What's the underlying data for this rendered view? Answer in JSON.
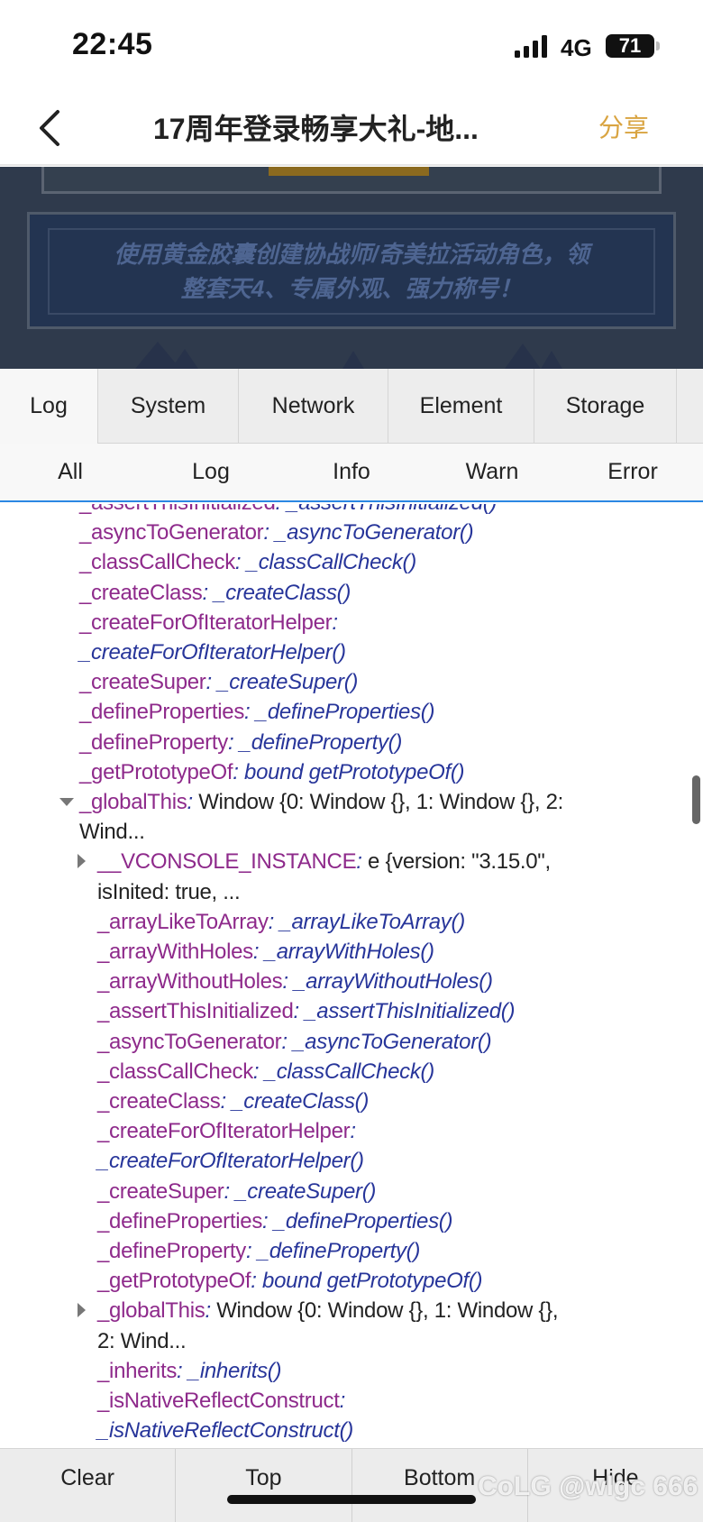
{
  "status_bar": {
    "time": "22:45",
    "network": "4G",
    "battery": "71",
    "icons": [
      "signal-icon",
      "battery-icon"
    ]
  },
  "nav": {
    "title": "17周年登录畅享大礼-地...",
    "share": "分享",
    "back_icon": "chevron-left-icon"
  },
  "banner": {
    "line1": "使用黄金胶囊创建协战师/奇美拉活动角色，领",
    "line2": "整套天4、专属外观、强力称号！"
  },
  "main_tabs": [
    "Log",
    "System",
    "Network",
    "Element",
    "Storage"
  ],
  "filter_tabs": [
    "All",
    "Log",
    "Info",
    "Warn",
    "Error"
  ],
  "log_lines": [
    {
      "key": "_assertThisInitialized",
      "value": "_assertThisInitialized()",
      "indent": 0
    },
    {
      "key": "_asyncToGenerator",
      "value": "_asyncToGenerator()",
      "indent": 0
    },
    {
      "key": "_classCallCheck",
      "value": "_classCallCheck()",
      "indent": 0
    },
    {
      "key": "_createClass",
      "value": "_createClass()",
      "indent": 0
    },
    {
      "key": "_createForOfIteratorHelper",
      "value": "",
      "indent": 0
    },
    {
      "key": "",
      "value": "_createForOfIteratorHelper()",
      "indent": 0
    },
    {
      "key": "_createSuper",
      "value": "_createSuper()",
      "indent": 0
    },
    {
      "key": "_defineProperties",
      "value": "_defineProperties()",
      "indent": 0
    },
    {
      "key": "_defineProperty",
      "value": "_defineProperty()",
      "indent": 0
    },
    {
      "key": "_getPrototypeOf",
      "value": "bound getPrototypeOf()",
      "indent": 0
    },
    {
      "key": "_globalThis",
      "value": "",
      "object": "Window {0: Window {}, 1: Window {}, 2:",
      "indent": 0,
      "caret": "down"
    },
    {
      "key": "",
      "value": "",
      "object": "Wind...",
      "indent": 0
    },
    {
      "key": "__VCONSOLE_INSTANCE",
      "value": "",
      "object": "e {version: \"3.15.0\",",
      "indent": 1,
      "caret": "right"
    },
    {
      "key": "",
      "value": "",
      "object": "isInited: true, ...",
      "indent": 1
    },
    {
      "key": "_arrayLikeToArray",
      "value": "_arrayLikeToArray()",
      "indent": 1
    },
    {
      "key": "_arrayWithHoles",
      "value": "_arrayWithHoles()",
      "indent": 1
    },
    {
      "key": "_arrayWithoutHoles",
      "value": "_arrayWithoutHoles()",
      "indent": 1
    },
    {
      "key": "_assertThisInitialized",
      "value": "_assertThisInitialized()",
      "indent": 1
    },
    {
      "key": "_asyncToGenerator",
      "value": "_asyncToGenerator()",
      "indent": 1
    },
    {
      "key": "_classCallCheck",
      "value": "_classCallCheck()",
      "indent": 1
    },
    {
      "key": "_createClass",
      "value": "_createClass()",
      "indent": 1
    },
    {
      "key": "_createForOfIteratorHelper",
      "value": "",
      "indent": 1
    },
    {
      "key": "",
      "value": "_createForOfIteratorHelper()",
      "indent": 1
    },
    {
      "key": "_createSuper",
      "value": "_createSuper()",
      "indent": 1
    },
    {
      "key": "_defineProperties",
      "value": "_defineProperties()",
      "indent": 1
    },
    {
      "key": "_defineProperty",
      "value": "_defineProperty()",
      "indent": 1
    },
    {
      "key": "_getPrototypeOf",
      "value": "bound getPrototypeOf()",
      "indent": 1
    },
    {
      "key": "_globalThis",
      "value": "",
      "object": "Window {0: Window {}, 1: Window {},",
      "indent": 1,
      "caret": "right"
    },
    {
      "key": "",
      "value": "",
      "object": "2: Wind...",
      "indent": 1
    },
    {
      "key": "_inherits",
      "value": "_inherits()",
      "indent": 1
    },
    {
      "key": "_isNativeReflectConstruct",
      "value": "",
      "indent": 1
    },
    {
      "key": "",
      "value": "_isNativeReflectConstruct()",
      "indent": 1
    }
  ],
  "toolbar": [
    "Clear",
    "Top",
    "Bottom",
    "Hide"
  ],
  "watermark": "CoLG @wlgc 666"
}
